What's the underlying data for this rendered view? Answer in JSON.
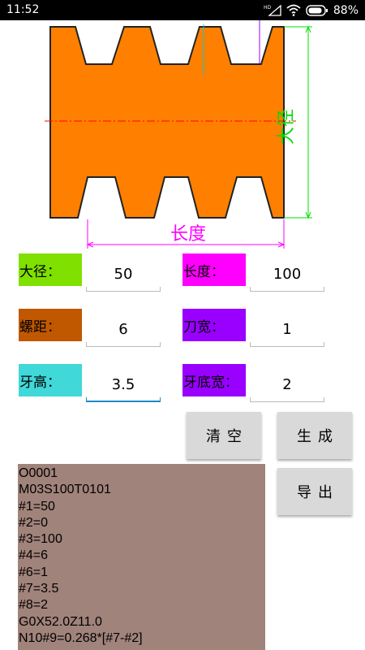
{
  "status_bar": {
    "time": "11:52",
    "battery_percent": "88%",
    "network_badge": "HD",
    "icons": [
      "signal-icon",
      "wifi-icon",
      "battery-icon"
    ]
  },
  "diagram": {
    "length_label": "长度",
    "diameter_label": "大径",
    "colors": {
      "body": "#ff8000",
      "centerline": "#ff0000",
      "length_dim": "#ff00ff",
      "diameter_dim": "#00e000",
      "marker": "#9900ff"
    }
  },
  "params": {
    "major_diameter": {
      "label": "大径：",
      "value": "50",
      "color": "#80e000"
    },
    "length": {
      "label": "长度：",
      "value": "100",
      "color": "#ff00ff"
    },
    "pitch": {
      "label": "螺距：",
      "value": "6",
      "color": "#c05800"
    },
    "tool_width": {
      "label": "刀宽：",
      "value": "1",
      "color": "#9900ff"
    },
    "tooth_height": {
      "label": "牙高：",
      "value": "3.5",
      "color": "#40d8d8"
    },
    "root_width": {
      "label": "牙底宽：",
      "value": "2",
      "color": "#9900ff"
    }
  },
  "buttons": {
    "clear": "清空",
    "generate": "生成",
    "export": "导出"
  },
  "output_lines": [
    "O0001",
    "M03S100T0101",
    "#1=50",
    "#2=0",
    "#3=100",
    "#4=6",
    "#6=1",
    "#7=3.5",
    "#8=2",
    "G0X52.0Z11.0",
    "N10#9=0.268*[#7-#2]"
  ]
}
